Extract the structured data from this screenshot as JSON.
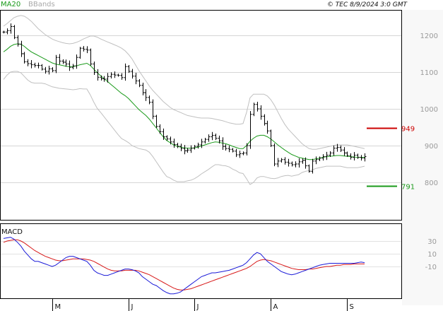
{
  "header": {
    "legend": [
      {
        "label": "MA20",
        "color": "#1a9a1a"
      },
      {
        "label": "BBands",
        "color": "#a8a8a8"
      }
    ],
    "source": "© TEC 8/9/2024 3:0 GMT"
  },
  "colors": {
    "ma": "#1a9a1a",
    "bbands": "#c0c0c0",
    "bars": "#000000",
    "macd": "#1a1ad8",
    "signal": "#d81a1a",
    "resistance": "#cc0000",
    "support": "#1a9a1a"
  },
  "chart_data": [
    {
      "type": "ohlc",
      "yticks": [
        800,
        900,
        1000,
        1100,
        1200
      ],
      "ylim": [
        700,
        1250
      ],
      "xlabels": [
        {
          "label": "M",
          "index": 14
        },
        {
          "label": "J",
          "index": 36
        },
        {
          "label": "J",
          "index": 55
        },
        {
          "label": "A",
          "index": 77
        },
        {
          "label": "S",
          "index": 99
        }
      ],
      "levels": [
        {
          "name": "resistance",
          "label": "949",
          "value": 949,
          "color": "#cc0000"
        },
        {
          "name": "support",
          "label": "791",
          "value": 791,
          "color": "#1a9a1a"
        }
      ],
      "close": [
        1209,
        1213,
        1224,
        1194,
        1176,
        1150,
        1128,
        1123,
        1120,
        1118,
        1118,
        1108,
        1102,
        1109,
        1104,
        1140,
        1130,
        1127,
        1122,
        1113,
        1117,
        1140,
        1165,
        1162,
        1160,
        1122,
        1099,
        1086,
        1082,
        1081,
        1088,
        1094,
        1092,
        1091,
        1085,
        1115,
        1102,
        1089,
        1076,
        1064,
        1044,
        1031,
        1018,
        980,
        952,
        938,
        924,
        918,
        910,
        903,
        898,
        892,
        886,
        888,
        893,
        898,
        902,
        910,
        917,
        924,
        928,
        920,
        913,
        898,
        892,
        890,
        885,
        875,
        878,
        880,
        900,
        985,
        1012,
        1000,
        980,
        960,
        940,
        900,
        850,
        858,
        862,
        855,
        852,
        848,
        850,
        856,
        860,
        845,
        830,
        858,
        862,
        866,
        870,
        874,
        880,
        893,
        895,
        888,
        880,
        873,
        868,
        874,
        868,
        866,
        870
      ],
      "ma20": [
        1155,
        1162,
        1170,
        1175,
        1177,
        1176,
        1170,
        1162,
        1155,
        1150,
        1145,
        1140,
        1135,
        1130,
        1125,
        1122,
        1120,
        1118,
        1116,
        1115,
        1115,
        1117,
        1120,
        1122,
        1124,
        1118,
        1108,
        1098,
        1090,
        1082,
        1074,
        1066,
        1058,
        1050,
        1042,
        1036,
        1028,
        1018,
        1008,
        998,
        990,
        982,
        972,
        960,
        948,
        936,
        924,
        914,
        908,
        902,
        898,
        896,
        894,
        893,
        893,
        894,
        896,
        899,
        902,
        905,
        908,
        910,
        909,
        907,
        905,
        902,
        898,
        895,
        892,
        892,
        900,
        912,
        920,
        926,
        928,
        928,
        924,
        918,
        910,
        902,
        895,
        888,
        882,
        876,
        872,
        868,
        866,
        864,
        862,
        862,
        864,
        866,
        868,
        870,
        871,
        872,
        873,
        873,
        872,
        871,
        870,
        869,
        868,
        868,
        868
      ],
      "bb_upper": [
        1225,
        1232,
        1240,
        1248,
        1252,
        1254,
        1252,
        1246,
        1238,
        1228,
        1218,
        1210,
        1202,
        1196,
        1190,
        1186,
        1183,
        1180,
        1178,
        1177,
        1178,
        1181,
        1185,
        1190,
        1194,
        1198,
        1198,
        1195,
        1190,
        1186,
        1182,
        1178,
        1174,
        1170,
        1165,
        1158,
        1148,
        1136,
        1120,
        1104,
        1090,
        1076,
        1062,
        1050,
        1040,
        1030,
        1020,
        1012,
        1004,
        998,
        994,
        990,
        986,
        982,
        980,
        978,
        976,
        975,
        975,
        975,
        974,
        972,
        970,
        968,
        965,
        962,
        960,
        958,
        958,
        960,
        990,
        1030,
        1040,
        1040,
        1040,
        1040,
        1035,
        1025,
        1010,
        992,
        974,
        958,
        945,
        935,
        925,
        915,
        905,
        898,
        892,
        890,
        890,
        892,
        894,
        896,
        898,
        900,
        902,
        902,
        902,
        902,
        900,
        898,
        896,
        894,
        892
      ],
      "bb_lower": [
        1080,
        1092,
        1100,
        1102,
        1102,
        1098,
        1088,
        1078,
        1072,
        1070,
        1070,
        1070,
        1068,
        1064,
        1060,
        1058,
        1056,
        1055,
        1054,
        1053,
        1052,
        1053,
        1055,
        1054,
        1054,
        1038,
        1018,
        1001,
        990,
        978,
        966,
        954,
        942,
        930,
        919,
        914,
        908,
        900,
        896,
        892,
        890,
        888,
        882,
        870,
        856,
        842,
        828,
        816,
        812,
        806,
        802,
        802,
        802,
        804,
        806,
        810,
        816,
        823,
        829,
        835,
        842,
        848,
        848,
        846,
        845,
        842,
        836,
        832,
        826,
        824,
        810,
        794,
        800,
        812,
        816,
        816,
        813,
        811,
        810,
        812,
        816,
        818,
        819,
        817,
        819,
        821,
        827,
        830,
        832,
        834,
        838,
        840,
        842,
        844,
        844,
        844,
        844,
        844,
        842,
        840,
        840,
        840,
        840,
        842,
        844
      ]
    },
    {
      "type": "line",
      "title": "MACD",
      "yticks": [
        30,
        10,
        -10
      ],
      "ylim": [
        -60,
        45
      ],
      "macd": [
        34,
        35,
        36,
        33,
        28,
        22,
        14,
        8,
        2,
        -2,
        -2,
        -4,
        -6,
        -8,
        -10,
        -8,
        -4,
        0,
        4,
        6,
        6,
        4,
        2,
        0,
        -2,
        -8,
        -16,
        -20,
        -22,
        -24,
        -24,
        -22,
        -20,
        -18,
        -16,
        -14,
        -14,
        -15,
        -17,
        -20,
        -26,
        -30,
        -34,
        -38,
        -40,
        -44,
        -48,
        -51,
        -53,
        -53,
        -52,
        -50,
        -46,
        -42,
        -38,
        -34,
        -30,
        -26,
        -24,
        -22,
        -20,
        -20,
        -19,
        -18,
        -17,
        -16,
        -14,
        -12,
        -10,
        -8,
        -4,
        2,
        8,
        12,
        10,
        4,
        -2,
        -6,
        -10,
        -14,
        -18,
        -20,
        -22,
        -23,
        -22,
        -20,
        -18,
        -16,
        -14,
        -12,
        -10,
        -8,
        -7,
        -6,
        -5,
        -5,
        -5,
        -5,
        -5,
        -5,
        -5,
        -5,
        -4,
        -3,
        -4
      ],
      "signal": [
        28,
        30,
        31,
        32,
        32,
        30,
        27,
        23,
        19,
        15,
        12,
        9,
        6,
        4,
        2,
        0,
        -1,
        -1,
        0,
        1,
        2,
        2,
        2,
        2,
        1,
        0,
        -2,
        -5,
        -8,
        -11,
        -14,
        -16,
        -17,
        -17,
        -17,
        -16,
        -16,
        -16,
        -16,
        -17,
        -19,
        -21,
        -23,
        -26,
        -29,
        -32,
        -35,
        -38,
        -41,
        -44,
        -46,
        -47,
        -47,
        -46,
        -45,
        -43,
        -41,
        -39,
        -37,
        -35,
        -33,
        -31,
        -29,
        -27,
        -25,
        -23,
        -21,
        -19,
        -17,
        -15,
        -13,
        -10,
        -6,
        -2,
        0,
        1,
        0,
        -1,
        -3,
        -5,
        -7,
        -9,
        -11,
        -13,
        -14,
        -15,
        -15,
        -15,
        -14,
        -14,
        -13,
        -12,
        -11,
        -10,
        -10,
        -9,
        -8,
        -8,
        -7,
        -7,
        -7,
        -6,
        -6,
        -6,
        -6
      ]
    }
  ]
}
